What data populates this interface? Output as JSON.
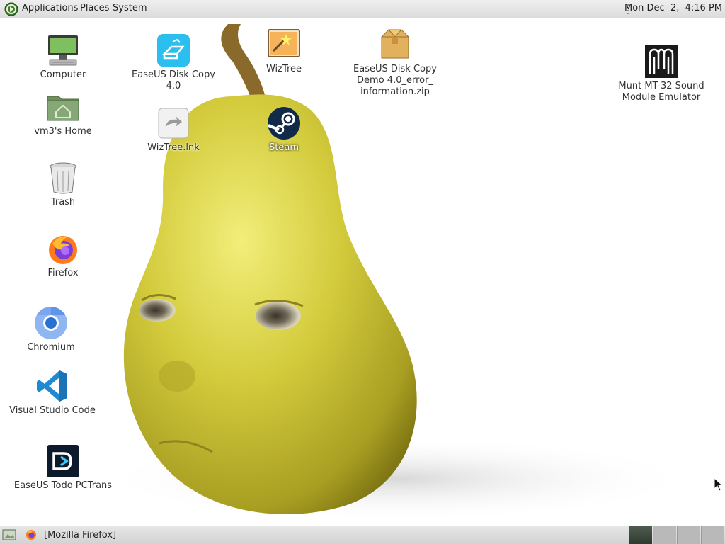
{
  "top_panel": {
    "menus": [
      "Applications",
      "Places",
      "System"
    ],
    "clock": "Mon Dec  2,  4:16 PM"
  },
  "desktop_icons": {
    "computer": "Computer",
    "home": "vm3's Home",
    "trash": "Trash",
    "firefox": "Firefox",
    "chromium": "Chromium",
    "vscode": "Visual Studio Code",
    "easeus_todo": "EaseUS Todo PCTrans",
    "easeus_disk_copy": "EaseUS Disk Copy 4.0",
    "wiztree_lnk": "WizTree.lnk",
    "wiztree": "WizTree",
    "steam": "Steam",
    "easeus_zip": "EaseUS Disk Copy\nDemo 4.0_error_\ninformation.zip",
    "munt": "Munt MT-32 Sound\nModule Emulator"
  },
  "bottom_panel": {
    "task": "[Mozilla Firefox]",
    "workspaces": [
      "1",
      "2",
      "3",
      "4"
    ],
    "active_workspace": 0
  },
  "colors": {
    "panel": "#dcdcdc",
    "pear": "#c9c23a",
    "vscode_blue": "#1f8ad2",
    "easeus_cyan": "#2bbff0"
  }
}
